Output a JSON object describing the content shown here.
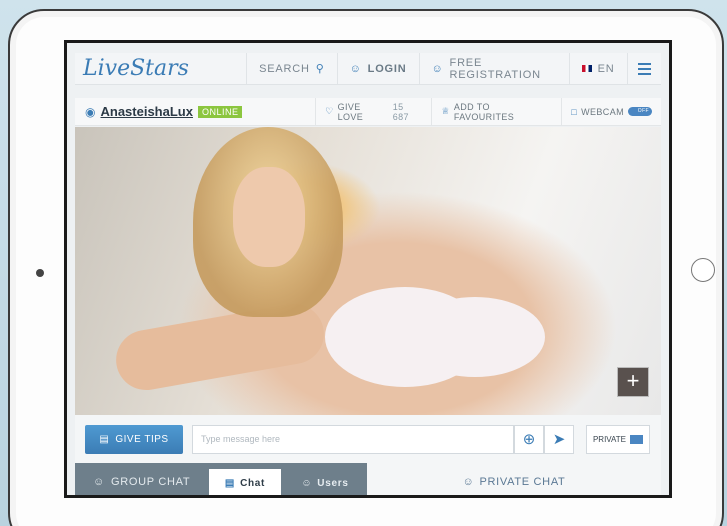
{
  "nav": {
    "logo": "LiveStars",
    "search": "SEARCH",
    "login": "LOGIN",
    "registration": "FREE REGISTRATION",
    "language": "EN"
  },
  "user": {
    "name": "AnasteishaLux",
    "status": "ONLINE",
    "give_love": "GIVE LOVE",
    "love_count": "15 687",
    "favourites": "ADD TO FAVOURITES",
    "webcam": "WEBCAM",
    "webcam_toggle": "OFF"
  },
  "message": {
    "tips": "GIVE TIPS",
    "placeholder": "Type message here",
    "private": "PRIVATE"
  },
  "tabs": {
    "group_chat": "GROUP CHAT",
    "chat": "Chat",
    "users": "Users",
    "private_chat": "PRIVATE CHAT"
  },
  "colors": {
    "accent": "#3b7cb5",
    "online": "#8cc63f",
    "group_bg": "#6e7f8b"
  }
}
